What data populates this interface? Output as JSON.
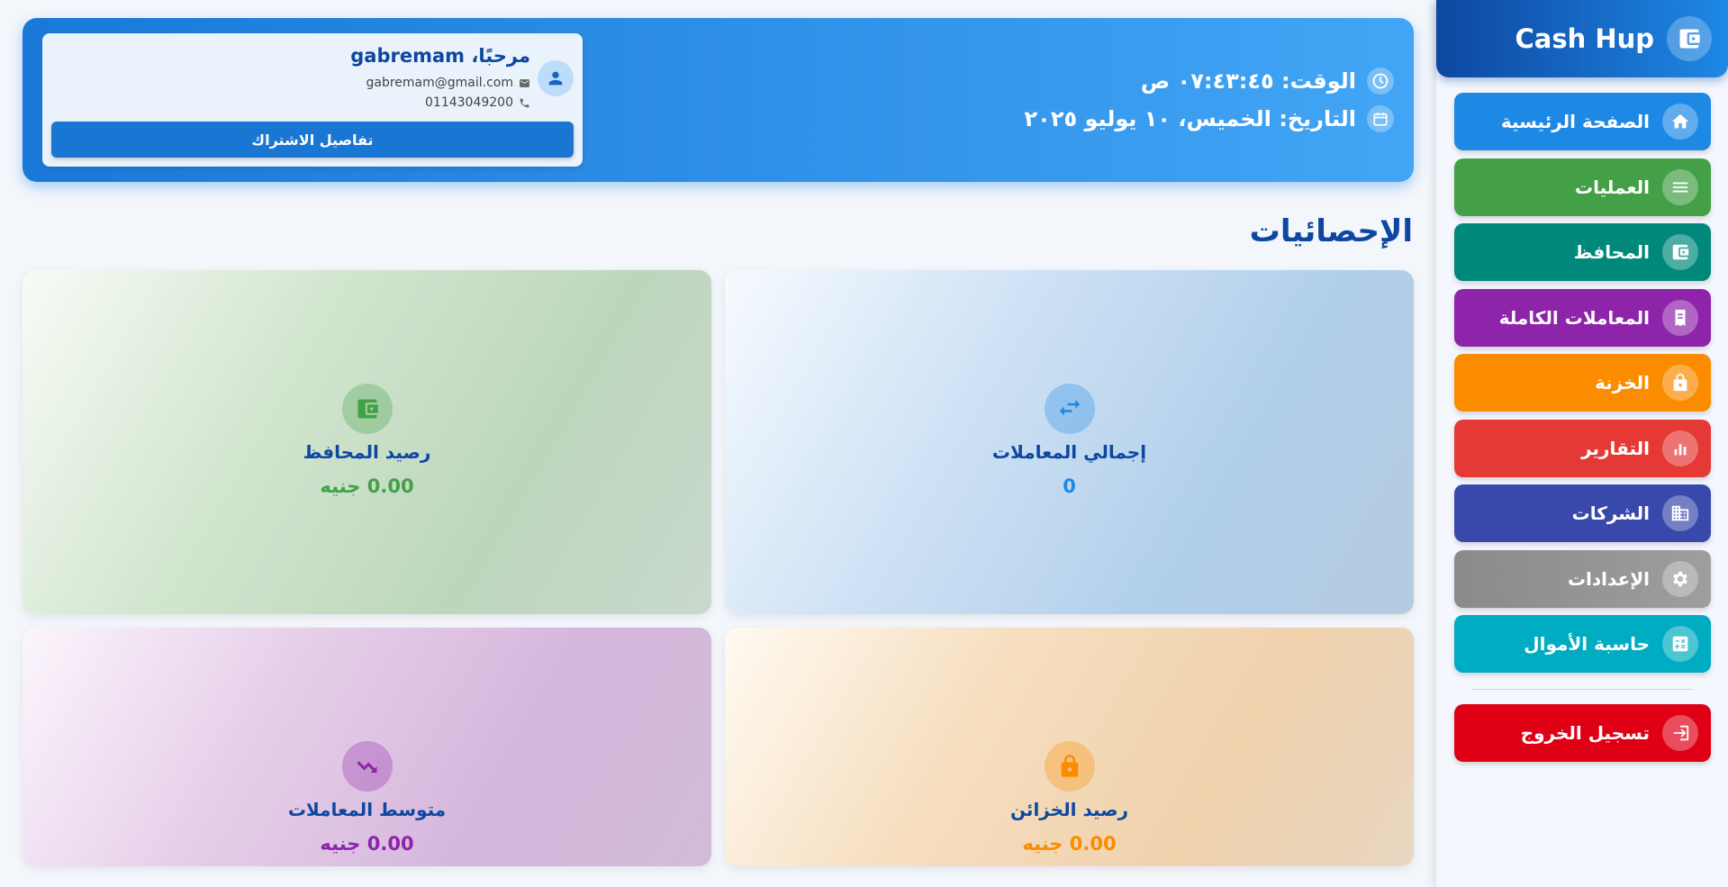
{
  "brand": {
    "title": "Cash Hup",
    "icon": "wallet-icon"
  },
  "nav": [
    {
      "label": "الصفحة الرئيسية",
      "icon": "home-icon",
      "color": "#1e88e5"
    },
    {
      "label": "العمليات",
      "icon": "list-icon",
      "color": "#43a047"
    },
    {
      "label": "المحافظ",
      "icon": "wallet-icon",
      "color": "#00897b"
    },
    {
      "label": "المعاملات الكاملة",
      "icon": "receipt-icon",
      "color": "#8e24aa"
    },
    {
      "label": "الخزنة",
      "icon": "lock-icon",
      "color": "#fb8c00"
    },
    {
      "label": "التقارير",
      "icon": "bar-chart-icon",
      "color": "#e53935"
    },
    {
      "label": "الشركات",
      "icon": "building-icon",
      "color": "#3949ab"
    },
    {
      "label": "الإعدادات",
      "icon": "gear-icon",
      "color": "#757575"
    },
    {
      "label": "حاسبة الأموال",
      "icon": "calculator-icon",
      "color": "#00acc1"
    }
  ],
  "logout": {
    "label": "تسجيل الخروج",
    "icon": "logout-icon",
    "color": "#e00016"
  },
  "header": {
    "time_text": "الوقت: ٠٧:٤٣:٤٥ ص",
    "date_text": "التاريخ: الخميس، ١٠ يوليو ٢٠٢٥",
    "greeting": "مرحبًا، gabremam",
    "email": "gabremam@gmail.com",
    "phone": "01143049200",
    "subscription_button": "تفاصيل الاشتراك"
  },
  "stats_title": "الإحصائيات",
  "stats": [
    {
      "label": "إجمالي المعاملات",
      "value": "0",
      "icon": "transfer-icon",
      "color": "#1e88e5"
    },
    {
      "label": "رصيد المحافظ",
      "value": "0.00 جنيه",
      "icon": "wallet-icon",
      "color": "#43a047"
    },
    {
      "label": "رصيد الخزائن",
      "value": "0.00 جنيه",
      "icon": "lock-icon",
      "color": "#fb8c00"
    },
    {
      "label": "متوسط المعاملات",
      "value": "0.00 جنيه",
      "icon": "trending-icon",
      "color": "#8e24aa"
    }
  ]
}
